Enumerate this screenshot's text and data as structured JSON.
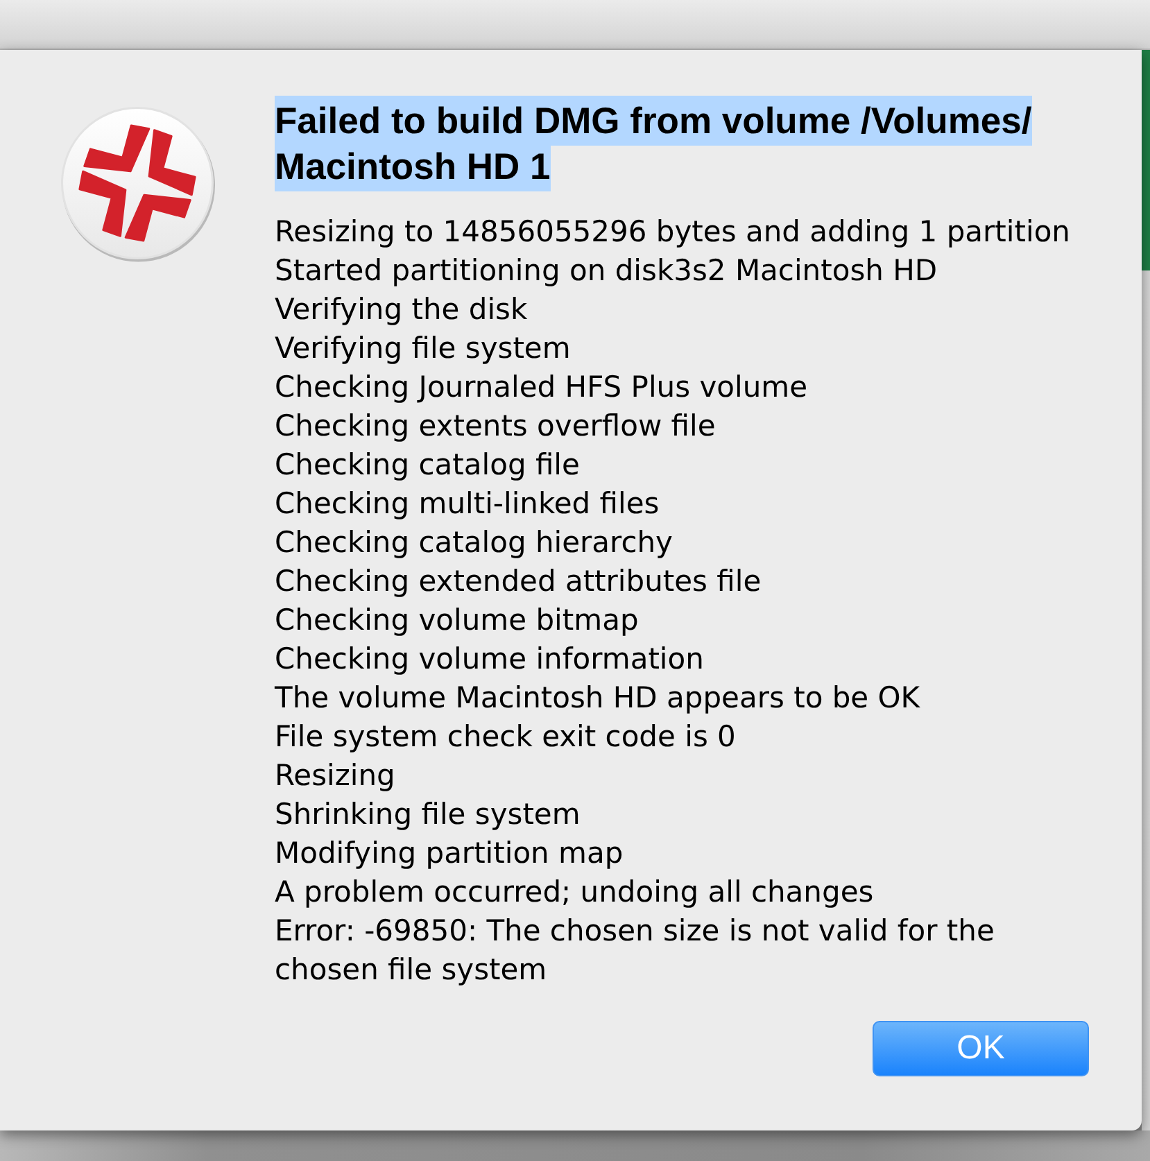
{
  "dialog": {
    "title": {
      "text": "Failed to build DMG from volume /Volumes/Macintosh HD 1",
      "selected": true
    },
    "messages": [
      "Resizing to 14856055296 bytes and adding 1 partition",
      "Started partitioning on disk3s2 Macintosh HD",
      "Verifying the disk",
      "Verifying file system",
      "Checking Journaled HFS Plus volume",
      "Checking extents overflow file",
      "Checking catalog file",
      "Checking multi-linked files",
      "Checking catalog hierarchy",
      "Checking extended attributes file",
      "Checking volume bitmap",
      "Checking volume information",
      "The volume Macintosh HD appears to be OK",
      "File system check exit code is 0",
      "Resizing",
      "Shrinking file system",
      "Modifying partition map",
      "A problem occurred; undoing all changes",
      "Error: -69850: The chosen size is not valid for the chosen file system"
    ],
    "buttons": [
      {
        "label": "OK",
        "default": true
      }
    ]
  }
}
